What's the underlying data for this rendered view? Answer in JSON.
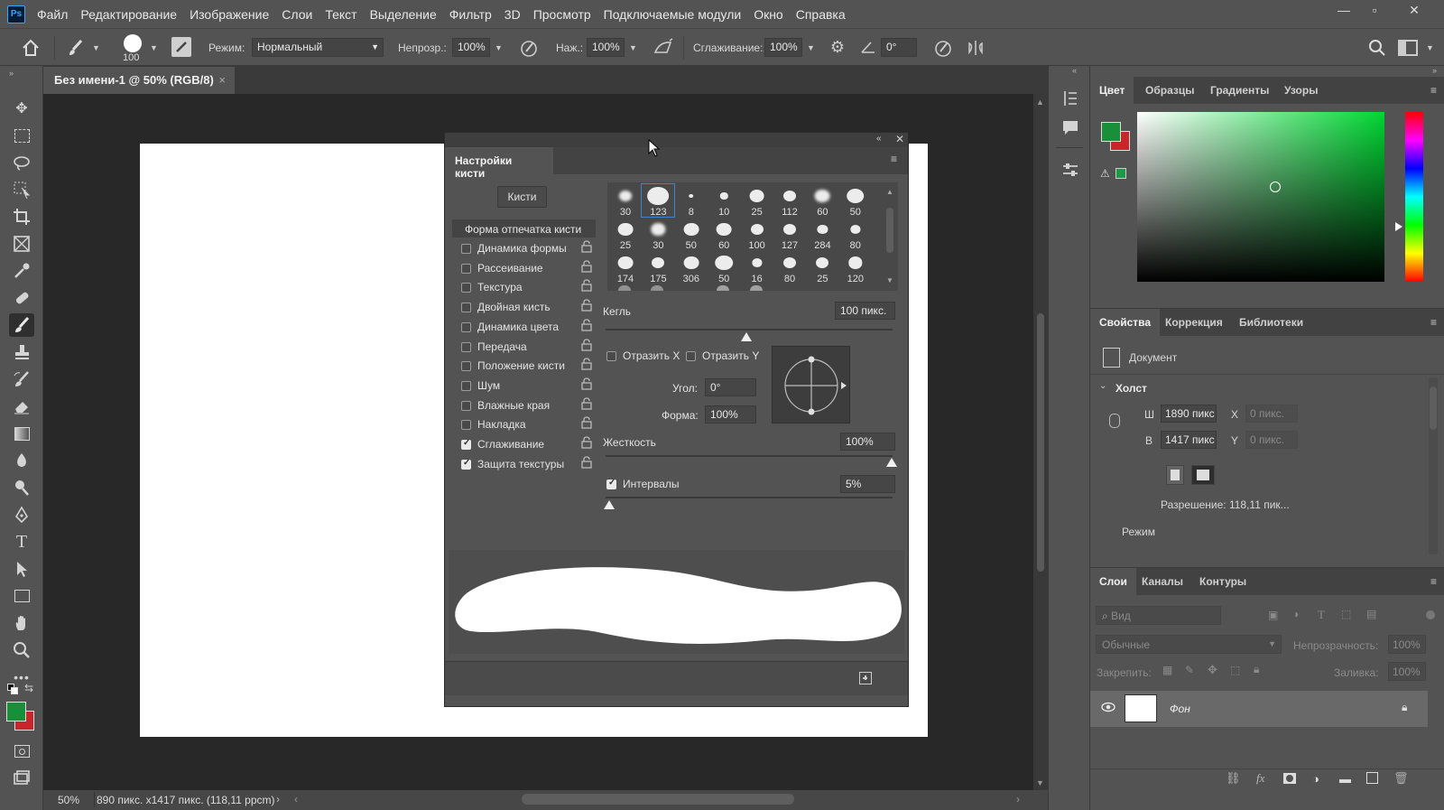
{
  "app": {
    "logo": "Ps"
  },
  "menu": [
    "Файл",
    "Редактирование",
    "Изображение",
    "Слои",
    "Текст",
    "Выделение",
    "Фильтр",
    "3D",
    "Просмотр",
    "Подключаемые модули",
    "Окно",
    "Справка"
  ],
  "window_controls": {
    "minimize": "—",
    "restore": "▫",
    "close": "✕"
  },
  "options": {
    "brush_size": "100",
    "mode_label": "Режим:",
    "mode_value": "Нормальный",
    "opacity_label": "Непрозр.:",
    "opacity_value": "100%",
    "pressure_label": "Наж.:",
    "pressure_value": "100%",
    "smoothing_label": "Сглаживание:",
    "smoothing_value": "100%",
    "angle_value": "0°"
  },
  "document": {
    "tab_title": "Без имени-1 @ 50% (RGB/8)",
    "zoom": "50%",
    "status": "890 пикс. x1417 пикс. (118,11 ppcm)"
  },
  "brush_panel": {
    "title": "Настройки кисти",
    "brushes_button": "Кисти",
    "tip_shape": "Форма отпечатка кисти",
    "options": [
      {
        "label": "Динамика формы",
        "checked": false
      },
      {
        "label": "Рассеивание",
        "checked": false
      },
      {
        "label": "Текстура",
        "checked": false
      },
      {
        "label": "Двойная кисть",
        "checked": false
      },
      {
        "label": "Динамика цвета",
        "checked": false
      },
      {
        "label": "Передача",
        "checked": false
      },
      {
        "label": "Положение кисти",
        "checked": false
      },
      {
        "label": "Шум",
        "checked": false
      },
      {
        "label": "Влажные края",
        "checked": false
      },
      {
        "label": "Накладка",
        "checked": false
      },
      {
        "label": "Сглаживание",
        "checked": true
      },
      {
        "label": "Защита текстуры",
        "checked": true
      }
    ],
    "presets": [
      "30",
      "123",
      "8",
      "10",
      "25",
      "112",
      "60",
      "50",
      "25",
      "30",
      "50",
      "60",
      "100",
      "127",
      "284",
      "80",
      "174",
      "175",
      "306",
      "50",
      "16",
      "80",
      "25",
      "120"
    ],
    "selected_preset": "123",
    "size_label": "Кегль",
    "size_value": "100 пикс.",
    "flip_x": "Отразить X",
    "flip_y": "Отразить Y",
    "angle_label": "Угол:",
    "angle_value": "0°",
    "roundness_label": "Форма:",
    "roundness_value": "100%",
    "hardness_label": "Жесткость",
    "hardness_value": "100%",
    "spacing_label": "Интервалы",
    "spacing_value": "5%",
    "spacing_checked": true
  },
  "color_panel": {
    "tabs": [
      "Цвет",
      "Образцы",
      "Градиенты",
      "Узоры"
    ],
    "foreground": "#1a8f3a",
    "background": "#c8262b"
  },
  "properties_panel": {
    "tabs": [
      "Свойства",
      "Коррекция",
      "Библиотеки"
    ],
    "doc_label": "Документ",
    "section": "Холст",
    "w_label": "Ш",
    "w_value": "1890 пикс",
    "h_label": "В",
    "h_value": "1417 пикс",
    "x_label": "X",
    "x_placeholder": "0 пикс.",
    "y_label": "Y",
    "y_placeholder": "0 пикс.",
    "resolution": "Разрешение: 118,11 пик...",
    "mode_label": "Режим"
  },
  "layers_panel": {
    "tabs": [
      "Слои",
      "Каналы",
      "Контуры"
    ],
    "search_placeholder": "Вид",
    "blend_mode": "Обычные",
    "opacity_label": "Непрозрачность:",
    "opacity_value": "100%",
    "lock_label": "Закрепить:",
    "fill_label": "Заливка:",
    "fill_value": "100%",
    "layer_name": "Фон"
  }
}
